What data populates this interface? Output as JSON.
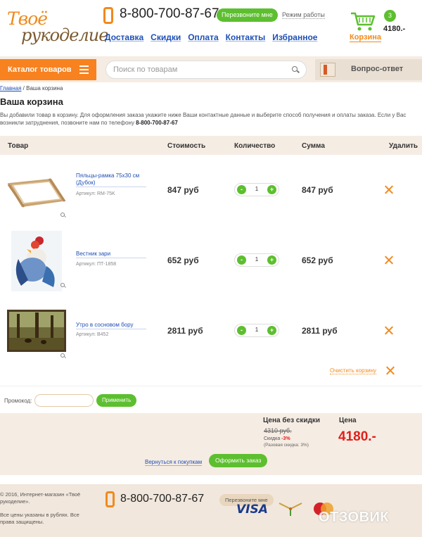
{
  "header": {
    "logo_line1": "Твоё",
    "logo_line2": "рукоделие",
    "phone": "8-800-700-87-67",
    "callback": "Перезвоните мне",
    "worktime": "Режим работы",
    "nav": [
      "Доставка",
      "Скидки",
      "Оплата",
      "Контакты",
      "Избранное"
    ],
    "cart_label": "Корзина",
    "cart_count": "3",
    "cart_sum": "4180.-"
  },
  "searchbar": {
    "catalog": "Каталог товаров",
    "search_placeholder": "Поиск по товарам",
    "qa": "Вопрос-ответ"
  },
  "breadcrumb": {
    "home": "Главная",
    "separator": " / ",
    "current": "Ваша корзина"
  },
  "page": {
    "title": "Ваша корзина",
    "intro_1": "Вы добавили товар в корзину. Для оформления заказа укажите ниже Ваши контактные данные и выберите способ получения и оплаты заказа. Если у Вас возникли затруднения, позвоните нам по телефону ",
    "intro_phone": "8-800-700-87-67"
  },
  "table": {
    "headers": [
      "Товар",
      "Стоимость",
      "Количество",
      "Сумма",
      "Удалить"
    ],
    "rows": [
      {
        "name": "Пяльцы-рамка 75х30 см (Дубок)",
        "sku": "Артикул: RM-75K",
        "price": "847 руб",
        "qty": "1",
        "sum": "847 руб"
      },
      {
        "name": "Вестник зари",
        "sku": "Артикул: ПТ-1858",
        "price": "652 руб",
        "qty": "1",
        "sum": "652 руб"
      },
      {
        "name": "Утро в сосновом бору",
        "sku": "Артикул: В452",
        "price": "2811 руб",
        "qty": "1",
        "sum": "2811 руб"
      }
    ],
    "minus": "-",
    "plus": "+",
    "clear": "Очистить корзину"
  },
  "promo": {
    "label": "Промокод:",
    "apply": "Применить"
  },
  "totals": {
    "no_discount_label": "Цена без скидки",
    "old_price": "4310 руб.",
    "discount_label": "Скидка ",
    "discount_value": "-3%",
    "once_discount": "(Разовая скидка: 3%)",
    "price_label": "Цена",
    "total": "4180.-",
    "back": "Вернуться к покупкам",
    "checkout": "Оформить заказ"
  },
  "footer": {
    "copyright": "© 2016, Интернет-магазин «Твоё рукоделие».",
    "prices_note": "Все цены указаны в рублях. Все права защищены.",
    "phone": "8-800-700-87-67",
    "callback": "Перезвоните мне",
    "visa": "VISA",
    "watermark": "ОТЗОВИК"
  },
  "colors": {
    "accent": "#f7821f",
    "green": "#5dbf2f",
    "link": "#1e4fb5",
    "beige": "#f5ece3",
    "red": "#e0201b"
  }
}
